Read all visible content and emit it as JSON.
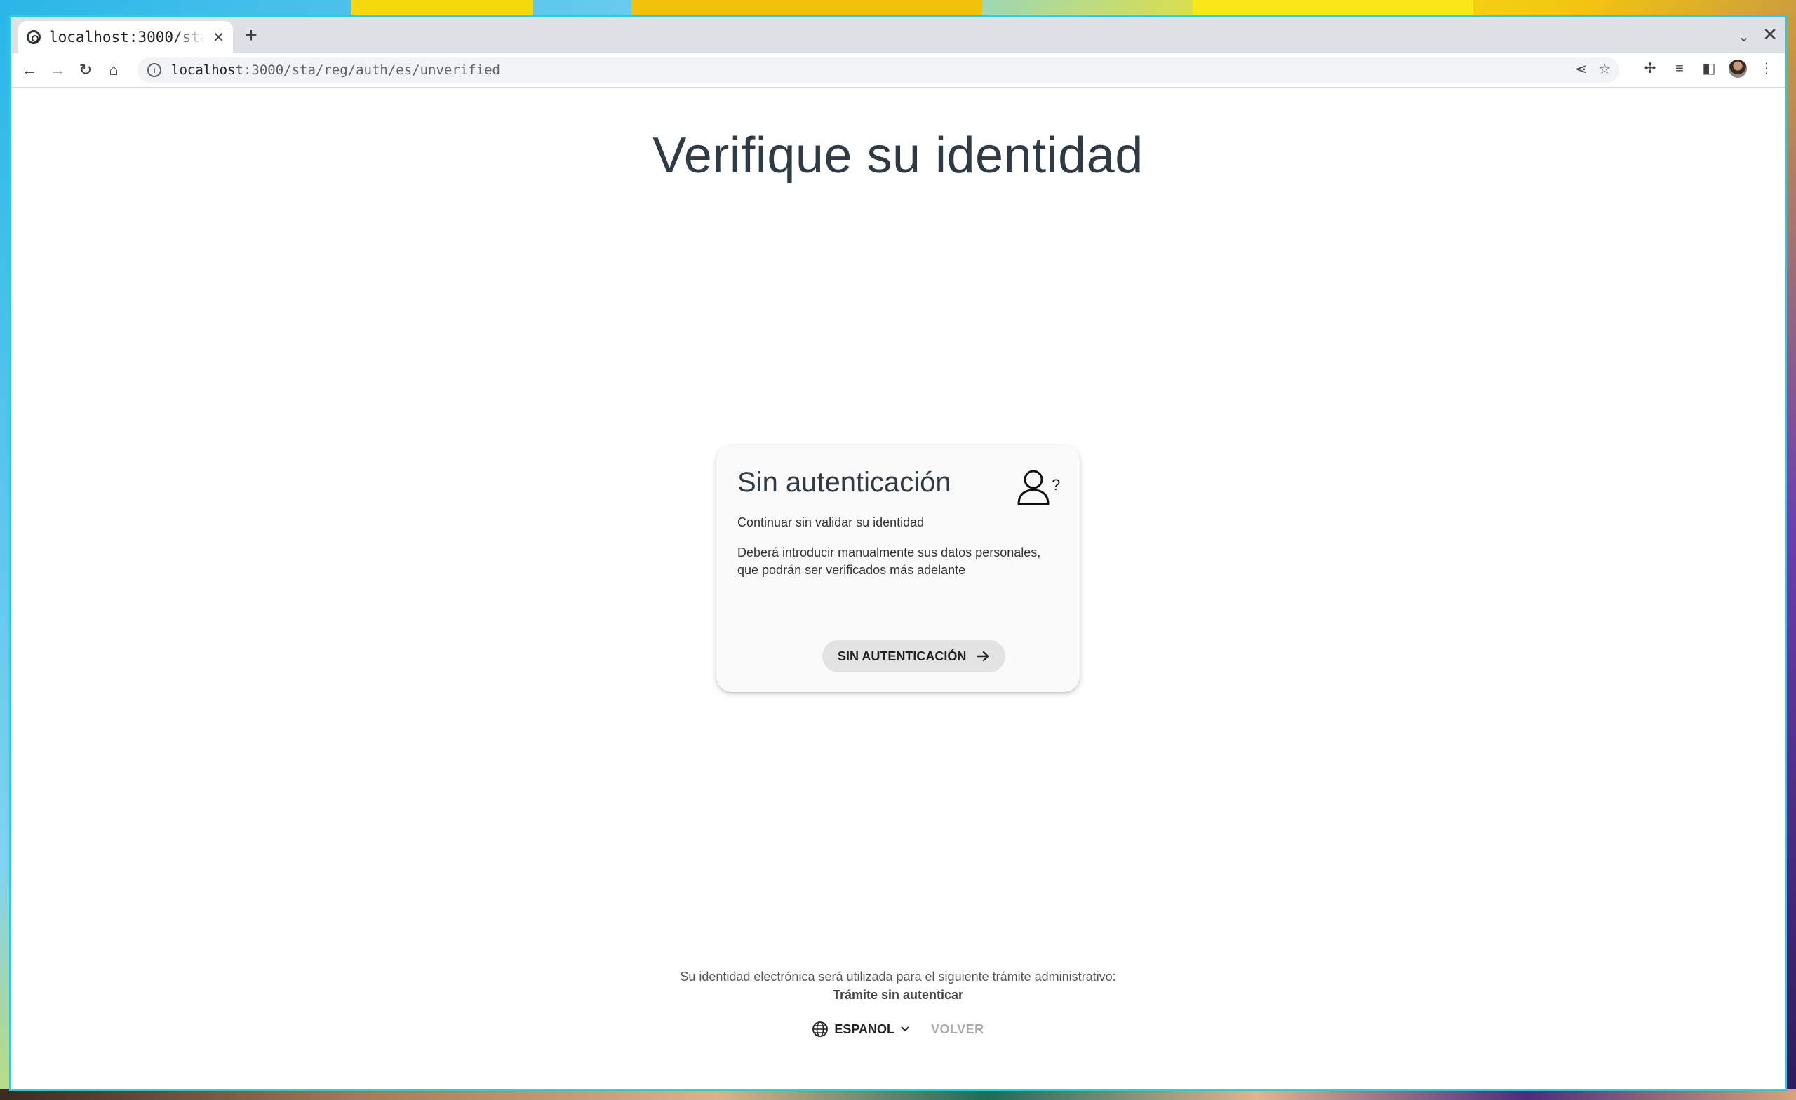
{
  "browser": {
    "tab_title": "localhost:3000/sta/reg/auth/es/unverified",
    "new_tab": "+",
    "close_tab": "✕",
    "url_host": "localhost",
    "url_rest": ":3000/sta/reg/auth/es/unverified"
  },
  "page": {
    "heading": "Verifique su identidad",
    "card": {
      "title": "Sin autenticación",
      "subtitle": "Continuar sin validar su identidad",
      "description": "Deberá introducir manualmente sus datos personales, que podrán ser verificados más adelante",
      "button_label": "SIN AUTENTICACIÓN",
      "icon": "user-question-icon"
    },
    "footer": {
      "note": "Su identidad electrónica será utilizada para el siguiente trámite administrativo:",
      "procedure": "Trámite sin autenticar",
      "language_label": "ESPANOL",
      "back_label": "VOLVER"
    }
  },
  "colors": {
    "heading": "#2f3a44",
    "card_bg": "#fafafa",
    "button_bg": "#e3e3e3",
    "back_disabled": "#a7acb1"
  }
}
